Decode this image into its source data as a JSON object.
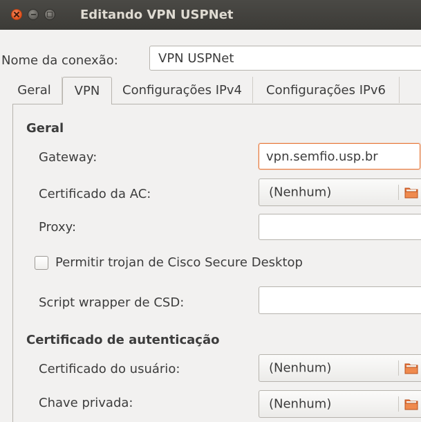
{
  "window": {
    "title": "Editando VPN USPNet"
  },
  "connection": {
    "name_label": "Nome da conexão:",
    "name_value": "VPN USPNet"
  },
  "tabs": [
    {
      "label": "Geral",
      "active": false
    },
    {
      "label": "VPN",
      "active": true
    },
    {
      "label": "Configurações IPv4",
      "active": false
    },
    {
      "label": "Configurações IPv6",
      "active": false
    }
  ],
  "general": {
    "heading": "Geral",
    "gateway_label": "Gateway:",
    "gateway_value": "vpn.semfio.usp.br",
    "ca_label": "Certificado da AC:",
    "ca_value": "(Nenhum)",
    "proxy_label": "Proxy:",
    "proxy_value": "",
    "csd_checkbox_label": "Permitir trojan de Cisco Secure Desktop",
    "csd_checked": false,
    "csd_script_label": "Script wrapper de CSD:",
    "csd_script_value": ""
  },
  "auth": {
    "heading": "Certificado de autenticação",
    "user_cert_label": "Certificado do usuário:",
    "user_cert_value": "(Nenhum)",
    "private_key_label": "Chave privada:",
    "private_key_value": "(Nenhum)"
  },
  "icons": {
    "close": "close-icon",
    "minimize": "minimize-icon",
    "maximize": "maximize-icon",
    "folder": "folder-icon"
  },
  "colors": {
    "titlebar": "#3c3b37",
    "focus_border": "#e97a3d",
    "folder": "#e8743b"
  }
}
